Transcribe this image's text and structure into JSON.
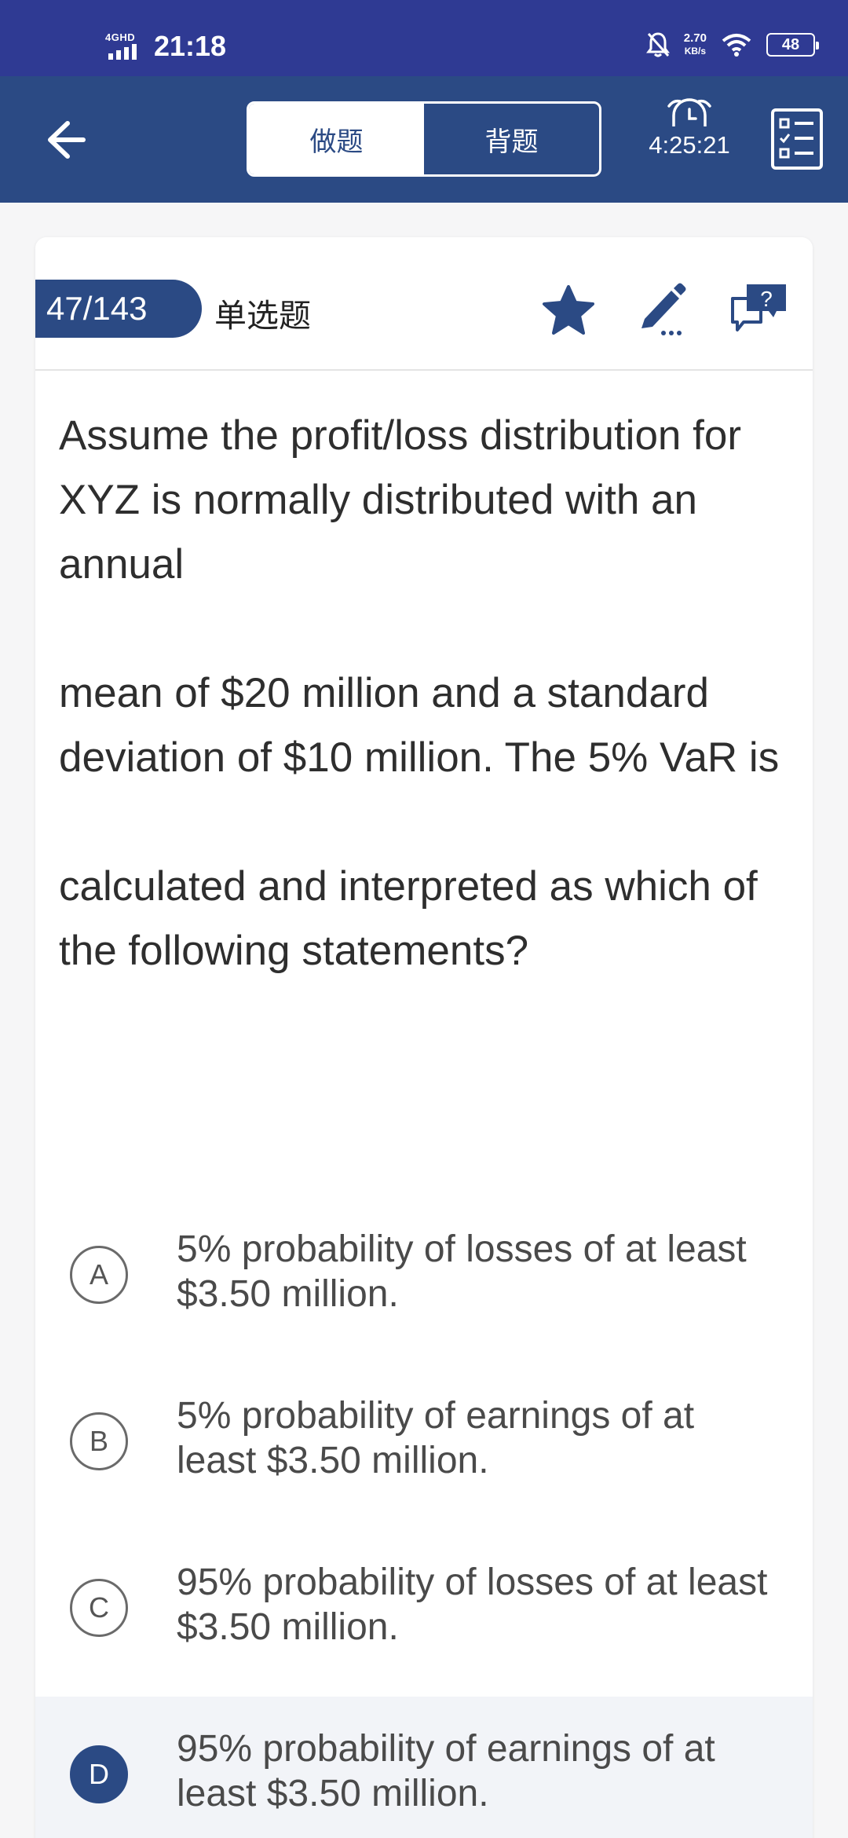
{
  "status_bar": {
    "network": "4GHD",
    "time": "21:18",
    "speed_value": "2.70",
    "speed_unit": "KB/s",
    "battery": "48"
  },
  "header": {
    "tabs": [
      {
        "label": "做题",
        "active": true
      },
      {
        "label": "背题",
        "active": false
      }
    ],
    "timer": "4:25:21",
    "icons": [
      "back-arrow-icon",
      "alarm-clock-icon",
      "checklist-icon"
    ]
  },
  "question": {
    "counter": "47/143",
    "type": "单选题",
    "icons": [
      "star-icon",
      "pencil-icon",
      "question-chat-icon"
    ],
    "paragraphs": [
      "Assume the profit/loss distribution for XYZ is normally distributed with an annual",
      "mean of $20 million and a standard deviation of $10 million. The 5% VaR is",
      "calculated and interpreted as which of the following statements?"
    ]
  },
  "options": [
    {
      "letter": "A",
      "text": "5% probability of losses of at least $3.50 million.",
      "selected": false
    },
    {
      "letter": "B",
      "text": "5% probability of earnings of at least $3.50 million.",
      "selected": false
    },
    {
      "letter": "C",
      "text": "95% probability of losses of at least $3.50 million.",
      "selected": false
    },
    {
      "letter": "D",
      "text": "95% probability of earnings of at least $3.50 million.",
      "selected": true
    }
  ],
  "colors": {
    "status_bar": "#2f3a93",
    "primary": "#2b4a84",
    "selected_row": "#f2f4f8"
  }
}
